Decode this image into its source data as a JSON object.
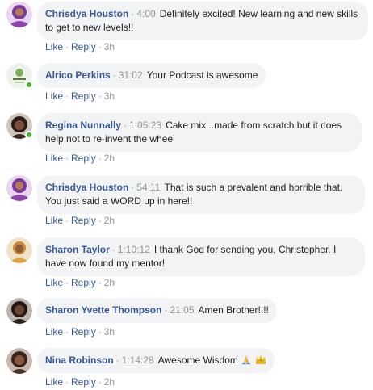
{
  "comments": [
    {
      "name": "Chrisdya Houston",
      "timestamp": "4:00",
      "text": "Definitely excited! New learning and new skills to get to new levels!!",
      "like_label": "Like",
      "reply_label": "Reply",
      "age": "3h",
      "avatar_color": "#6b2d8e",
      "online": false
    },
    {
      "name": "Alrico Perkins",
      "timestamp": "31:02",
      "text": "Your Podcast is awesome",
      "like_label": "Like",
      "reply_label": "Reply",
      "age": "3h",
      "avatar_color": "#e8efe4",
      "online": true
    },
    {
      "name": "Regina Nunnally",
      "timestamp": "1:05:23",
      "text": "Cake mix...made from scratch but it does help not to re-invent the wheel",
      "like_label": "Like",
      "reply_label": "Reply",
      "age": "2h",
      "avatar_color": "#5a3a2a",
      "online": true
    },
    {
      "name": "Chrisdya Houston",
      "timestamp": "54:11",
      "text": "That is such a prevalent and horrible that. You just said a WORD up in here!!",
      "like_label": "Like",
      "reply_label": "Reply",
      "age": "2h",
      "avatar_color": "#6b2d8e",
      "online": false
    },
    {
      "name": "Sharon Taylor",
      "timestamp": "1:10:12",
      "text": "I thank God for sending you, Christopher. I have now found my mentor!",
      "like_label": "Like",
      "reply_label": "Reply",
      "age": "2h",
      "avatar_color": "#d9a35a",
      "online": false
    },
    {
      "name": "Sharon Yvette Thompson",
      "timestamp": "21:05",
      "text": "Amen Brother!!!!",
      "like_label": "Like",
      "reply_label": "Reply",
      "age": "3h",
      "avatar_color": "#2e2522",
      "online": false
    },
    {
      "name": "Nina Robinson",
      "timestamp": "1:14:28",
      "text": "Awesome Wisdom",
      "like_label": "Like",
      "reply_label": "Reply",
      "age": "2h",
      "avatar_color": "#4a2e2a",
      "online": false,
      "emojis": [
        "folded-hands-emoji",
        "crown-emoji"
      ]
    }
  ],
  "separator": "·"
}
